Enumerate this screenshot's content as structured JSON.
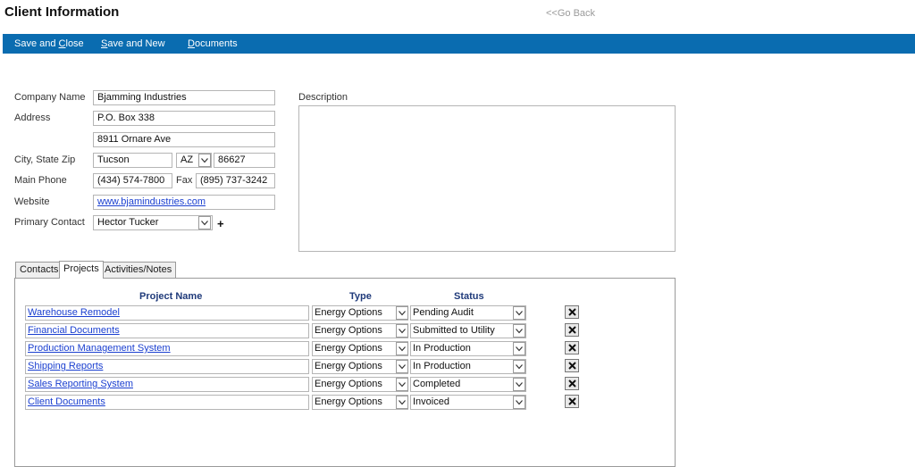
{
  "header": {
    "title": "Client Information",
    "go_back": "<<Go Back"
  },
  "toolbar": {
    "save_close": {
      "pre": "Save and ",
      "u": "C",
      "post": "lose"
    },
    "save_new": {
      "pre": "",
      "u": "S",
      "post": "ave and New"
    },
    "documents": {
      "pre": "",
      "u": "D",
      "post": "ocuments"
    }
  },
  "form": {
    "company_label": "Company Name",
    "company": "Bjamming Industries",
    "address_label": "Address",
    "address1": "P.O. Box 338",
    "address2": "8911 Ornare Ave",
    "csz_label": "City, State Zip",
    "city": "Tucson",
    "state": "AZ",
    "zip": "86627",
    "phone_label": "Main Phone",
    "phone": "(434) 574-7800",
    "fax_label": "Fax",
    "fax": "(895) 737-3242",
    "website_label": "Website",
    "website": "www.bjamindustries.com",
    "contact_label": "Primary Contact",
    "contact": "Hector Tucker",
    "add_contact": "+",
    "description_label": "Description"
  },
  "tabs": [
    "Contacts",
    "Projects",
    "Activities/Notes"
  ],
  "projects": {
    "headers": {
      "name": "Project Name",
      "type": "Type",
      "status": "Status"
    },
    "rows": [
      {
        "name": "Warehouse Remodel",
        "type": "Energy Options",
        "status": "Pending Audit"
      },
      {
        "name": "Financial Documents",
        "type": "Energy Options",
        "status": "Submitted to Utility"
      },
      {
        "name": "Production Management System",
        "type": "Energy Options",
        "status": "In Production"
      },
      {
        "name": "Shipping Reports",
        "type": "Energy Options",
        "status": "In Production"
      },
      {
        "name": "Sales Reporting System",
        "type": "Energy Options",
        "status": "Completed"
      },
      {
        "name": "Client Documents",
        "type": "Energy Options",
        "status": "Invoiced"
      }
    ]
  }
}
